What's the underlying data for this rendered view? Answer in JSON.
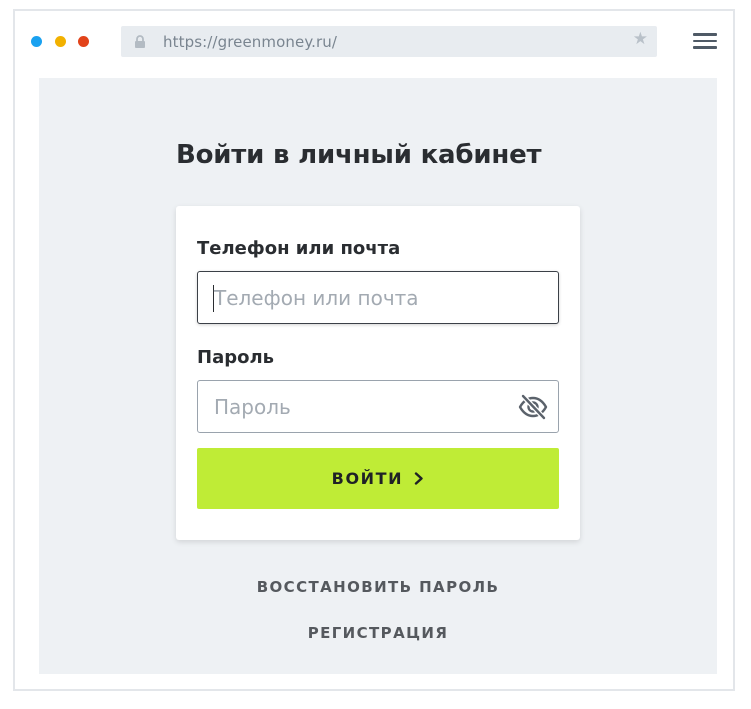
{
  "browser": {
    "url": "https://greenmoney.ru/",
    "window_dots": [
      "#1aa1f0",
      "#f2b100",
      "#e2431a"
    ],
    "icons": {
      "lock": "lock-icon",
      "bookmark": "star-icon",
      "menu": "hamburger-menu-icon"
    }
  },
  "page": {
    "title": "Войти в личный кабинет"
  },
  "login_form": {
    "login_label": "Телефон или почта",
    "login_placeholder": "Телефон или почта",
    "password_label": "Пароль",
    "password_placeholder": "Пароль",
    "password_toggle_icon": "eye-off-icon",
    "submit_label": "ВОЙТИ",
    "submit_icon": "chevron-right-icon"
  },
  "links": {
    "restore_password": "ВОССТАНОВИТЬ ПАРОЛЬ",
    "register": "РЕГИСТРАЦИЯ"
  },
  "colors": {
    "accent_button": "#bfec36",
    "content_background": "#eef1f4",
    "text_dark": "#2a2d31"
  }
}
